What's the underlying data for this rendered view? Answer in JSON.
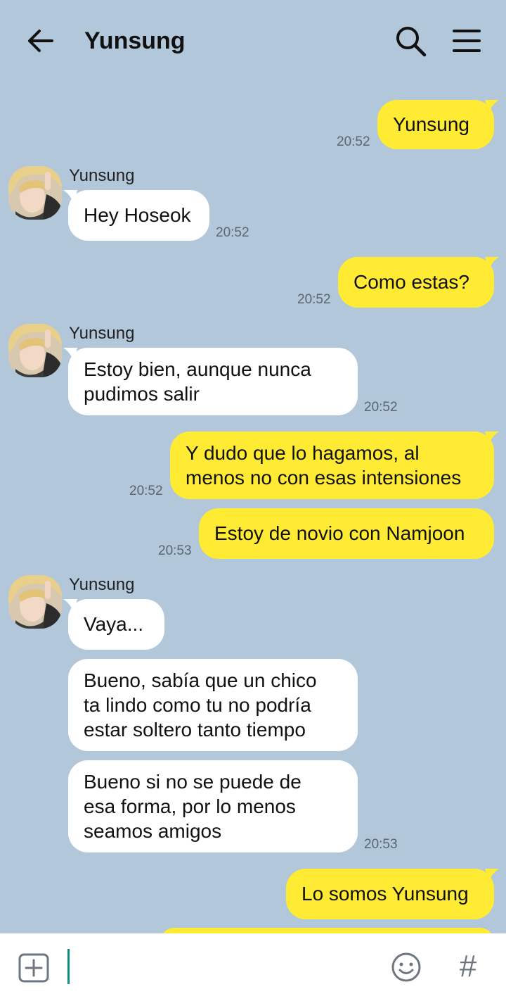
{
  "header": {
    "title": "Yunsung"
  },
  "contact": {
    "name": "Yunsung"
  },
  "messages": [
    {
      "side": "me",
      "lines": [
        "Yunsung"
      ],
      "time": "20:52"
    },
    {
      "side": "them",
      "lines": [
        "Hey Hoseok"
      ],
      "time": "20:52",
      "sender": "Yunsung"
    },
    {
      "side": "me",
      "lines": [
        "Como estas?"
      ],
      "time": "20:52"
    },
    {
      "side": "them",
      "lines": [
        "Estoy bien, aunque nunca",
        "pudimos salir"
      ],
      "time": "20:52",
      "sender": "Yunsung"
    },
    {
      "side": "me",
      "lines": [
        "Y dudo que lo hagamos, al",
        "menos no con esas intensiones"
      ],
      "time": "20:52"
    },
    {
      "side": "me",
      "lines": [
        "Estoy de novio con Namjoon"
      ],
      "time": "20:53"
    },
    {
      "side": "them",
      "lines": [
        "Vaya..."
      ],
      "time": "",
      "sender": "Yunsung"
    },
    {
      "side": "them",
      "lines": [
        "Bueno, sabía que un chico",
        "ta lindo como tu no podría",
        "estar soltero tanto tiempo"
      ],
      "time": ""
    },
    {
      "side": "them",
      "lines": [
        "Bueno si no se puede de",
        "esa forma, por lo menos",
        "seamos amigos"
      ],
      "time": "20:53"
    },
    {
      "side": "me",
      "lines": [
        "Lo somos Yunsung"
      ],
      "time": ""
    }
  ],
  "composer": {
    "hash_label": "#"
  },
  "colors": {
    "background": "#b2c7d9",
    "my_bubble": "#ffeb33",
    "their_bubble": "#ffffff",
    "caret": "#0e8f7e"
  }
}
